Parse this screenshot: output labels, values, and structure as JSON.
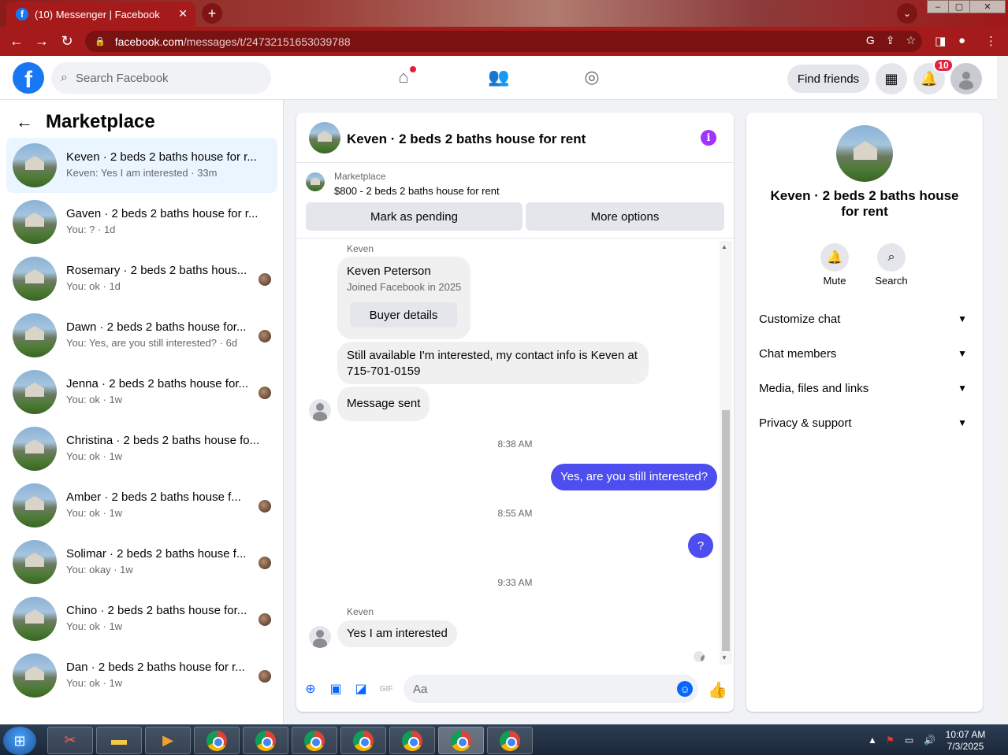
{
  "browser": {
    "tab_title": "(10) Messenger | Facebook",
    "url_host": "facebook.com",
    "url_path": "/messages/t/24732151653039788"
  },
  "header": {
    "search_placeholder": "Search Facebook",
    "find_friends": "Find friends",
    "notification_count": "10"
  },
  "sidebar": {
    "title": "Marketplace",
    "conversations": [
      {
        "title": "Keven · 2 beds 2 baths house for r...",
        "preview": "Keven: Yes I am interested · 33m"
      },
      {
        "title": "Gaven · 2 beds 2 baths house for r...",
        "preview": "You: ? · 1d"
      },
      {
        "title": "Rosemary · 2 beds 2 baths hous...",
        "preview": "You: ok · 1d"
      },
      {
        "title": "Dawn · 2 beds 2 baths house for...",
        "preview": "You: Yes, are you still interested? · 6d"
      },
      {
        "title": "Jenna · 2 beds 2 baths house for...",
        "preview": "You: ok · 1w"
      },
      {
        "title": "Christina · 2 beds 2 baths house fo...",
        "preview": "You: ok · 1w"
      },
      {
        "title": "Amber · 2 beds 2 baths house f...",
        "preview": "You: ok · 1w"
      },
      {
        "title": "Solimar · 2 beds 2 baths house f...",
        "preview": "You: okay · 1w"
      },
      {
        "title": "Chino · 2 beds 2 baths house for...",
        "preview": "You: ok · 1w"
      },
      {
        "title": "Dan · 2 beds 2 baths house for r...",
        "preview": "You: ok · 1w"
      }
    ]
  },
  "chat": {
    "title": "Keven · 2 beds 2 baths house for rent",
    "marketplace_label": "Marketplace",
    "listing": "$800 - 2 beds 2 baths house for rent",
    "mark_pending": "Mark as pending",
    "more_options": "More options",
    "sender1": "Keven",
    "card_name": "Keven Peterson",
    "card_sub": "Joined Facebook in 2025",
    "buyer_details": "Buyer details",
    "msg1_line1": "Still available I'm interested, my contact info is Keven at",
    "msg1_line2": "715-701-0159",
    "msg2": "Message sent",
    "time1": "8:38 AM",
    "out1": "Yes, are you still interested?",
    "time2": "8:55 AM",
    "out2": "?",
    "time3": "9:33 AM",
    "sender2": "Keven",
    "msg3": "Yes I am interested",
    "composer_placeholder": "Aa"
  },
  "details": {
    "title_line1": "Keven · 2 beds 2 baths house",
    "title_line2": "for rent",
    "mute": "Mute",
    "search": "Search",
    "sections": [
      "Customize chat",
      "Chat members",
      "Media, files and links",
      "Privacy & support"
    ]
  },
  "taskbar": {
    "time": "10:07 AM",
    "date": "7/3/2025"
  },
  "colors": {
    "brand": "#1877f2",
    "outgoing": "#4d4df0",
    "chrome_red": "#a51b1b",
    "info_purple": "#a033ff"
  }
}
